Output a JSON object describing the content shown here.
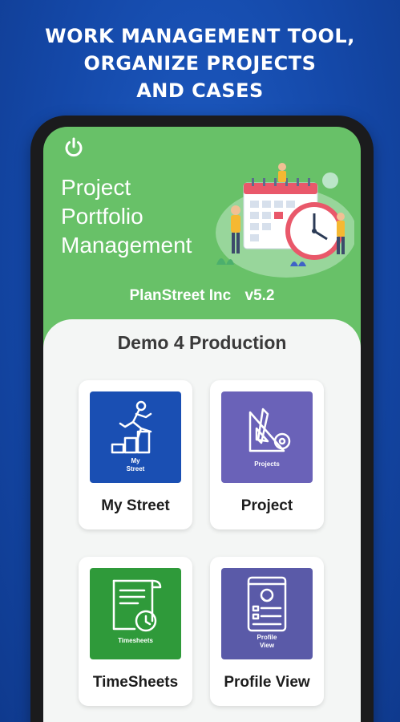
{
  "promo": {
    "line1": "WORK MANAGEMENT TOOL,",
    "line2": "ORGANIZE PROJECTS",
    "line3": "AND CASES"
  },
  "header": {
    "title_line1": "Project",
    "title_line2": "Portfolio",
    "title_line3": "Management",
    "organization": "PlanStreet Inc",
    "version": "v5.2"
  },
  "environment": "Demo 4 Production",
  "cards": {
    "my_street": {
      "label": "My Street",
      "tile_caption": "My\nStreet",
      "icon": "runner-stairs-icon",
      "color": "#1a4fb3"
    },
    "project": {
      "label": "Project",
      "tile_caption": "Projects",
      "icon": "drafting-tools-icon",
      "color": "#6a62b8"
    },
    "timesheets": {
      "label": "TimeSheets",
      "tile_caption": "Timesheets",
      "icon": "timesheet-clock-icon",
      "color": "#2f9a3a"
    },
    "profile_view": {
      "label": "Profile View",
      "tile_caption": "Profile\nView",
      "icon": "profile-card-icon",
      "color": "#5a5aa8"
    }
  },
  "colors": {
    "background": "#1448a8",
    "header_green": "#68c168",
    "panel": "#f4f6f5"
  }
}
